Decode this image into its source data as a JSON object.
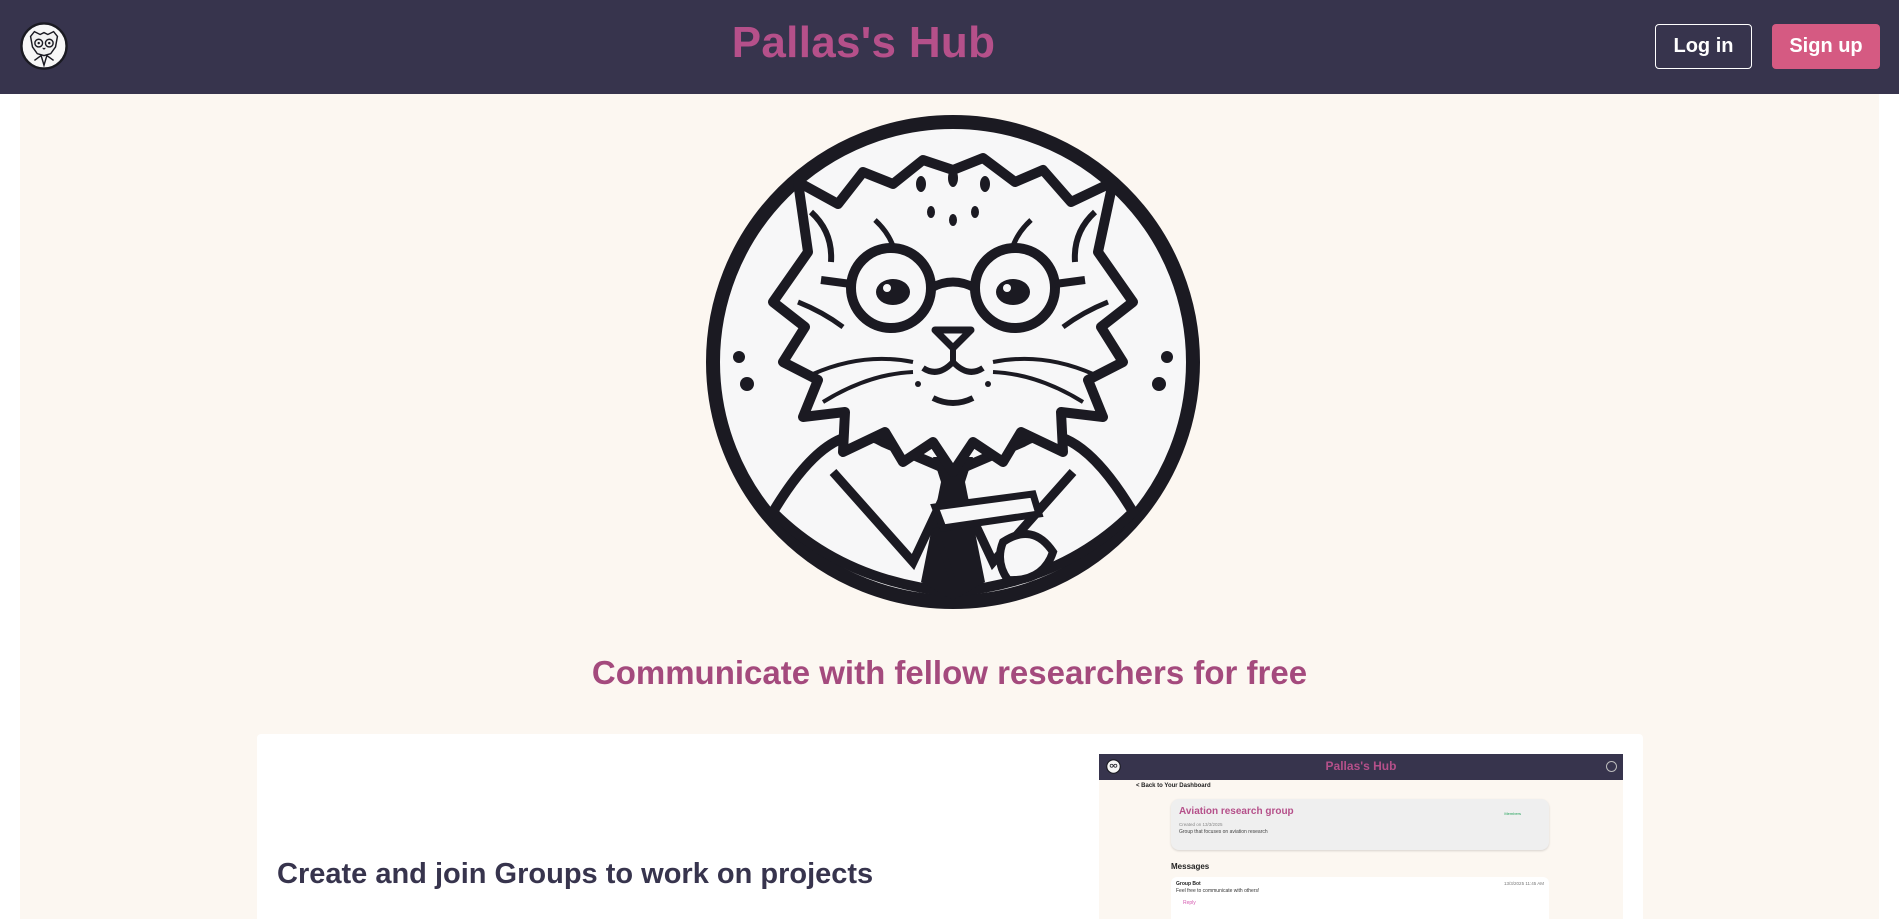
{
  "header": {
    "title": "Pallas's Hub",
    "login_label": "Log in",
    "signup_label": "Sign up",
    "logo_icon": "pallas-cat-logo-icon"
  },
  "hero": {
    "logo_icon": "pallas-cat-scholar-illustration",
    "tagline": "Communicate with fellow researchers for free"
  },
  "feature": {
    "heading": "Create and join Groups to work on projects",
    "preview": {
      "app_title": "Pallas's Hub",
      "back_link": "< Back to Your Dashboard",
      "group_name": "Aviation research group",
      "group_badge": "Members",
      "group_created": "Created on 13/3/2025",
      "group_description": "Group that focuses on aviation research",
      "messages_heading": "Messages",
      "message_author": "Group Bot",
      "message_time": "13/3/2025 11:45 AM",
      "message_text": "Feel free to communicate with others!",
      "reply_label": "Reply"
    }
  },
  "colors": {
    "header_bg": "#37344d",
    "brand_pink": "#b5508a",
    "signup_bg": "#d55a82",
    "page_bg": "#fcf7f1"
  }
}
